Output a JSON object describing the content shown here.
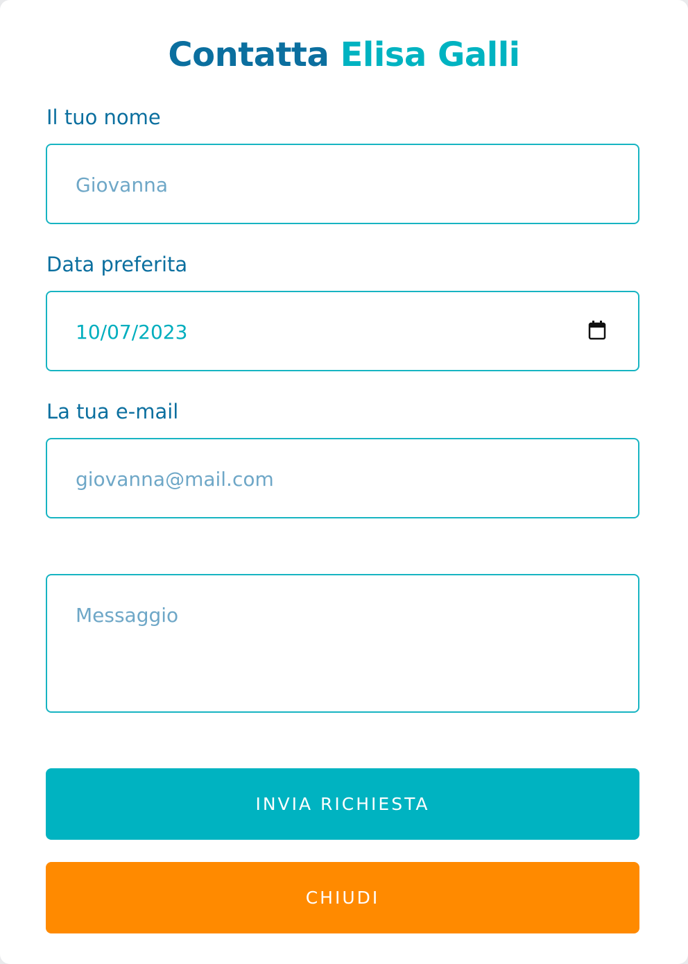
{
  "title": {
    "prefix": "Contatta",
    "name": "Elisa Galli"
  },
  "form": {
    "name_label": "Il tuo nome",
    "name_placeholder": "Giovanna",
    "date_label": "Data preferita",
    "date_value": "10/07/2023",
    "email_label": "La tua e-mail",
    "email_placeholder": "giovanna@mail.com",
    "message_placeholder": "Messaggio"
  },
  "buttons": {
    "send_label": "INVIA RICHIESTA",
    "close_label": "CHIUDI"
  },
  "icons": {
    "date_picker": "calendar-icon"
  },
  "colors": {
    "primary_blue": "#0b6f9f",
    "accent_teal": "#00b3c1",
    "close_orange": "#ff8a00",
    "placeholder": "#6ea7c7"
  }
}
